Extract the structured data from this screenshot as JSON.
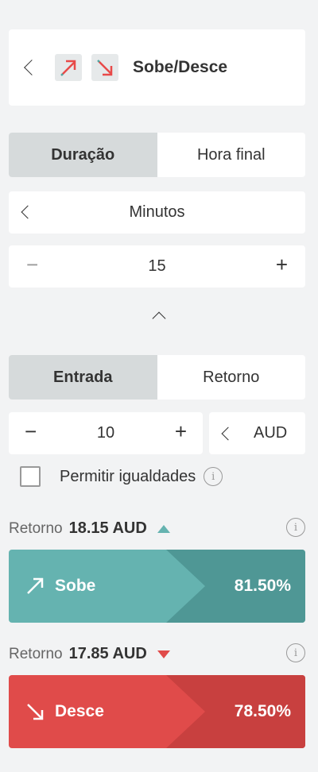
{
  "header": {
    "title": "Sobe/Desce"
  },
  "duration": {
    "tabs": [
      "Duração",
      "Hora final"
    ],
    "unit": "Minutos",
    "value": "15",
    "minus": "−",
    "plus": "+"
  },
  "stake": {
    "tabs": [
      "Entrada",
      "Retorno"
    ],
    "value": "10",
    "minus": "−",
    "plus": "+",
    "currency": "AUD",
    "allow_equals": "Permitir igualdades"
  },
  "rise": {
    "payout_label": "Retorno",
    "payout_value": "18.15 AUD",
    "button_label": "Sobe",
    "percent": "81.50%",
    "color": "#65b3b0",
    "color_dark": "#4f9795"
  },
  "fall": {
    "payout_label": "Retorno",
    "payout_value": "17.85 AUD",
    "button_label": "Desce",
    "percent": "78.50%",
    "color": "#e04b4a",
    "color_dark": "#c8403f"
  },
  "icons": {
    "back": "chevron-left-icon",
    "collapse": "chevron-up-icon",
    "info": "info-icon",
    "rise": "arrow-up-right-icon",
    "fall": "arrow-down-right-icon"
  }
}
